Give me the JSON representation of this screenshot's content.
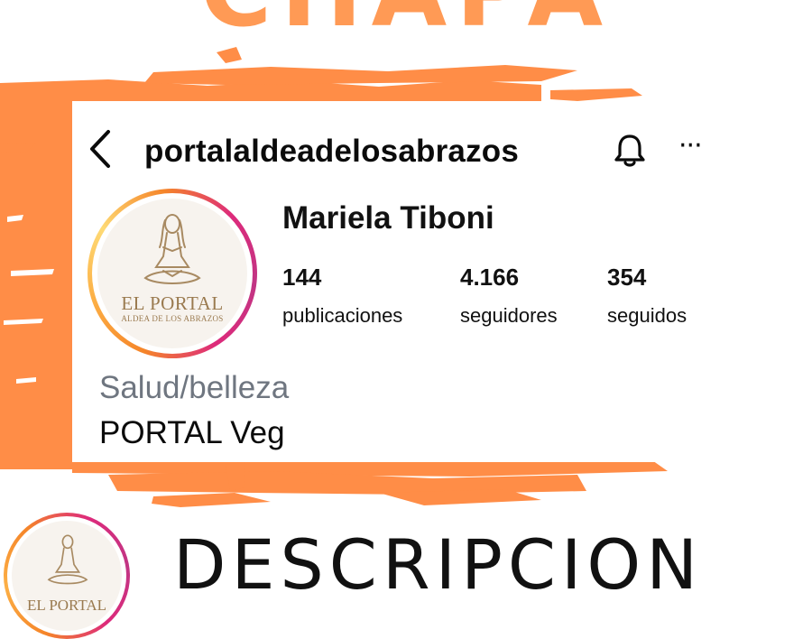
{
  "headline": "CHAPA",
  "profile": {
    "username": "portalaldeadelosabrazos",
    "display_name": "Mariela Tiboni",
    "stats": [
      {
        "value": "144",
        "label": "publicaciones"
      },
      {
        "value": "4.166",
        "label": "seguidores"
      },
      {
        "value": "354",
        "label": "seguidos"
      }
    ],
    "category": "Salud/belleza",
    "bio": "PORTAL Veg",
    "logo_title": "EL PORTAL",
    "logo_subtitle": "ALDEA DE LOS ABRAZOS"
  },
  "header_icons": {
    "back": "chevron-left-icon",
    "bell": "bell-icon",
    "more": "more-horizontal-icon"
  },
  "bottom": {
    "logo_title": "EL PORTAL",
    "description": "DESCRIPCION"
  },
  "colors": {
    "accent_orange": "#ff9a55",
    "ring_gradient": [
      "#f58529",
      "#dd2a7b",
      "#c13584"
    ],
    "logo_brown": "#9a7a4f"
  }
}
